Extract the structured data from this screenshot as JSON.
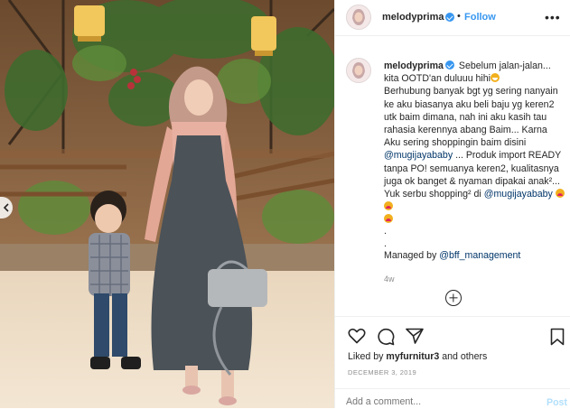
{
  "post": {
    "username": "melodyprima",
    "follow_label": "Follow",
    "dot_separator": "•",
    "more_glyph": "•••",
    "caption": {
      "username": "melodyprima",
      "text_line1": " Sebelum jalan-jalan...",
      "text_line2": "kita OOTD'an duluuu hihi",
      "text_body_a": "Berhubung banyak bgt yg sering nanyain ke aku biasanya aku beli baju yg keren2 utk baim dimana, nah ini aku kasih tau rahasia kerennya abang Baim... Karna Aku sering shoppingin baim disini ",
      "mention1": "@mugijayababy",
      "text_body_b": " ... Produk import READY tanpa PO! semuanya keren2, kualitasnya juga ok banget & nyaman dipakai anak²... Yuk serbu shopping² di ",
      "mention2": "@mugijayababy",
      "dot1": ".",
      "dot2": ".",
      "managed_prefix": "Managed by ",
      "managed_mention": "@bff_management"
    },
    "time_ago": "4w",
    "likes_prefix": "Liked by ",
    "liked_by_user": "myfurnitur3",
    "likes_suffix": " and others",
    "date": "DECEMBER 3, 2019",
    "comment_placeholder": "Add a comment...",
    "post_label": "Post"
  },
  "icons": {
    "avatar": "avatar-photo",
    "verified": "verified-badge-icon",
    "more": "more-options-icon",
    "like": "heart-icon",
    "comment": "comment-icon",
    "share": "share-icon",
    "save": "bookmark-icon",
    "load_more": "plus-circle-icon",
    "carousel_prev": "chevron-left-icon"
  },
  "colors": {
    "accent": "#3897f0",
    "mention": "#003569",
    "muted": "#8e8e8e",
    "post_disabled": "#b2dffc"
  }
}
